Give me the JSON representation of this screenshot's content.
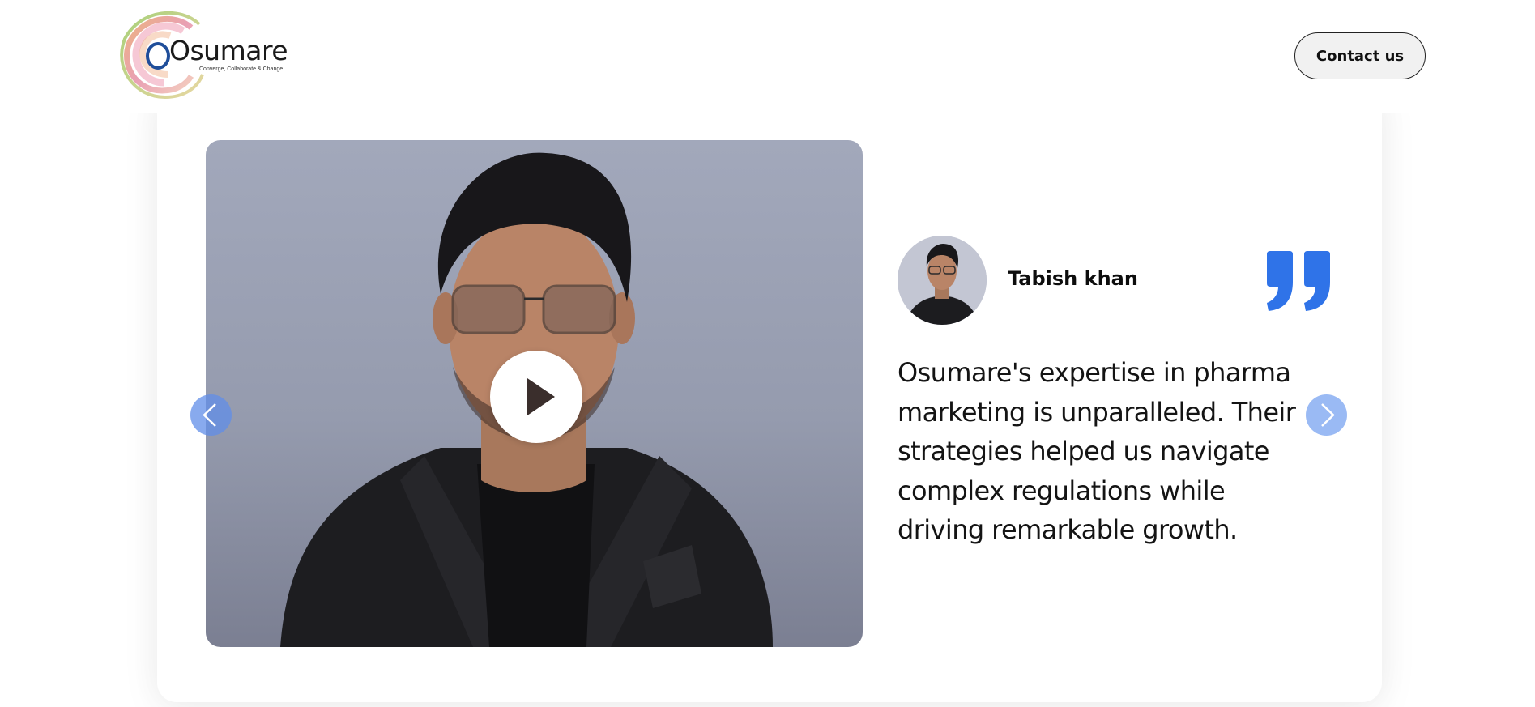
{
  "header": {
    "logo": {
      "word": "Osumare",
      "tagline": "Converge, Collaborate & Change..."
    },
    "contact_button": "Contact us"
  },
  "testimonial": {
    "name": "Tabish khan",
    "quote": "Osumare's expertise in pharma marketing is unparalleled. Their strategies helped us navigate complex regulations while driving remarkable growth.",
    "quote_icon": "quote-icon",
    "accent_color": "#2f73e8"
  },
  "video": {
    "play_icon": "play-icon"
  },
  "navigation": {
    "prev_icon": "chevron-left-icon",
    "next_icon": "chevron-right-icon"
  }
}
